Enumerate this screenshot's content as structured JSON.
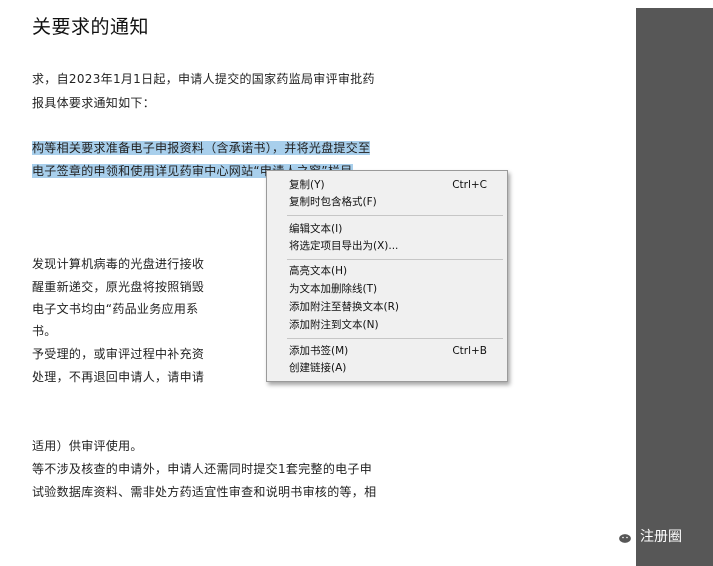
{
  "document": {
    "title": "关要求的通知",
    "lines": [
      "求，自2023年1月1日起，申请人提交的国家药监局审评审批药",
      "报具体要求通知如下：",
      "构等相关要求准备电子申报资料（含承诺书），并将光盘提交至",
      "电子签章的申领和使用详见药审中心网站“申请人之窗”栏目",
      "发现计算机病毒的光盘进行接收",
      "醒重新递交，原光盘将按照销毁",
      "电子文书均由“药品业务应用系",
      "书。",
      "予受理的，或审评过程中补充资",
      "处理，不再退回申请人，请申请",
      "适用）供审评使用。",
      "等不涉及核查的申请外，申请人还需同时提交1套完整的电子申",
      "试验数据库资料、需非处方药适宜性审查和说明书审核的等，相"
    ]
  },
  "context_menu": {
    "items": [
      {
        "label": "复制(Y)",
        "shortcut": "Ctrl+C"
      },
      {
        "label": "复制时包含格式(F)",
        "shortcut": ""
      },
      {
        "label": "编辑文本(I)",
        "shortcut": ""
      },
      {
        "label": "将选定项目导出为(X)...",
        "shortcut": ""
      },
      {
        "label": "高亮文本(H)",
        "shortcut": ""
      },
      {
        "label": "为文本加删除线(T)",
        "shortcut": ""
      },
      {
        "label": "添加附注至替换文本(R)",
        "shortcut": ""
      },
      {
        "label": "添加附注到文本(N)",
        "shortcut": ""
      },
      {
        "label": "添加书签(M)",
        "shortcut": "Ctrl+B"
      },
      {
        "label": "创建链接(A)",
        "shortcut": ""
      }
    ]
  },
  "watermark": {
    "text": "注册圈",
    "icon": "wechat-icon"
  },
  "colors": {
    "selection": "#a8cfec",
    "side_panel": "#575757",
    "menu_bg": "#f0f0f0"
  }
}
